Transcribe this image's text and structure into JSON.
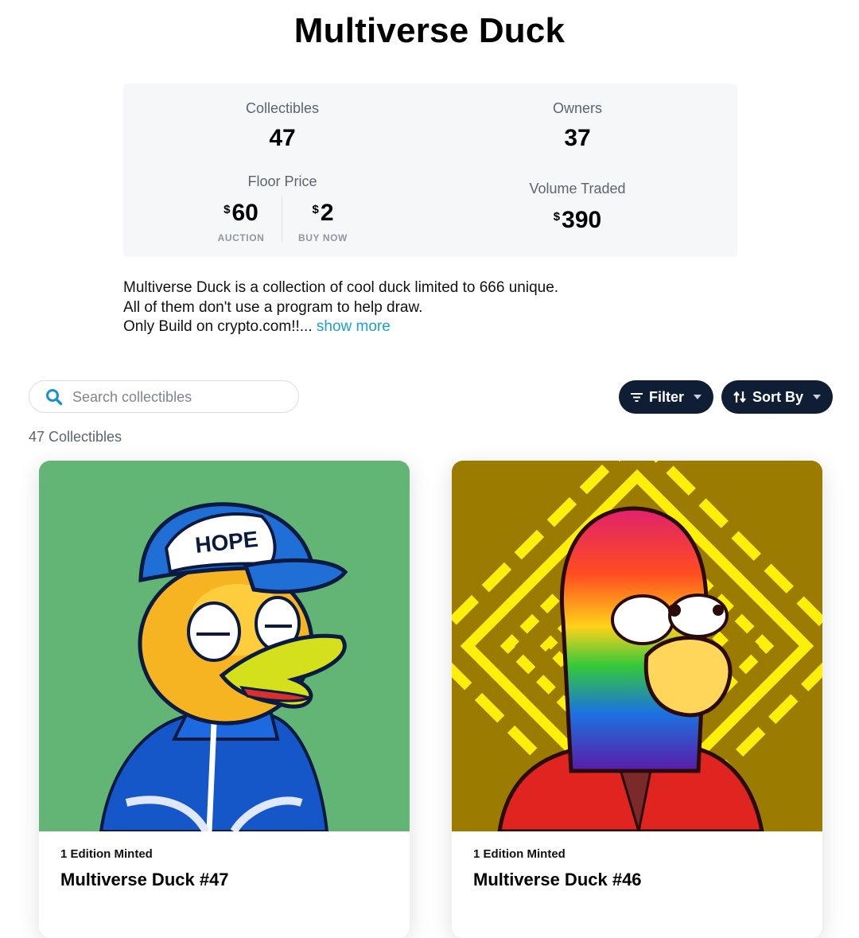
{
  "page_title": "Multiverse Duck",
  "stats": {
    "collectibles": {
      "label": "Collectibles",
      "value": "47"
    },
    "owners": {
      "label": "Owners",
      "value": "37"
    },
    "floor_price": {
      "label": "Floor Price",
      "auction": {
        "currency": "$",
        "value": "60",
        "label": "AUCTION"
      },
      "buy_now": {
        "currency": "$",
        "value": "2",
        "label": "BUY NOW"
      }
    },
    "volume_traded": {
      "label": "Volume Traded",
      "currency": "$",
      "value": "390"
    }
  },
  "description": {
    "line1": "Multiverse Duck is a collection of cool duck limited to 666 unique.",
    "line2": "All of them don't use a program to help draw.",
    "line3": "Only Build on crypto.com!!...",
    "show_more": "show more"
  },
  "toolbar": {
    "search_placeholder": "Search collectibles",
    "filter_label": "Filter",
    "sort_label": "Sort By",
    "count_text": "47 Collectibles"
  },
  "cards": [
    {
      "edition": "1 Edition Minted",
      "title": "Multiverse Duck #47",
      "hat_text": "HOPE",
      "bg_color": "#62b574"
    },
    {
      "edition": "1 Edition Minted",
      "title": "Multiverse Duck #46",
      "bg_color": "#9b7b00"
    }
  ],
  "colors": {
    "accent": "#1a9fd8",
    "button_bg": "#0f1d35",
    "stats_bg": "#f6f7f9"
  }
}
